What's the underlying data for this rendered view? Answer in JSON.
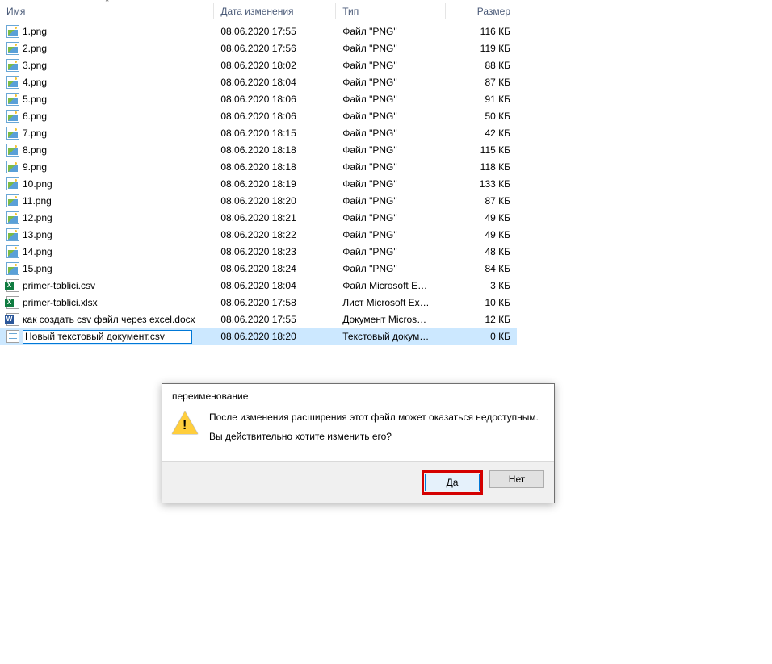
{
  "columns": {
    "name": "Имя",
    "date": "Дата изменения",
    "type": "Тип",
    "size": "Размер"
  },
  "files": [
    {
      "icon": "img",
      "name": "1.png",
      "date": "08.06.2020 17:55",
      "type": "Файл \"PNG\"",
      "size": "116 КБ"
    },
    {
      "icon": "img",
      "name": "2.png",
      "date": "08.06.2020 17:56",
      "type": "Файл \"PNG\"",
      "size": "119 КБ"
    },
    {
      "icon": "img",
      "name": "3.png",
      "date": "08.06.2020 18:02",
      "type": "Файл \"PNG\"",
      "size": "88 КБ"
    },
    {
      "icon": "img",
      "name": "4.png",
      "date": "08.06.2020 18:04",
      "type": "Файл \"PNG\"",
      "size": "87 КБ"
    },
    {
      "icon": "img",
      "name": "5.png",
      "date": "08.06.2020 18:06",
      "type": "Файл \"PNG\"",
      "size": "91 КБ"
    },
    {
      "icon": "img",
      "name": "6.png",
      "date": "08.06.2020 18:06",
      "type": "Файл \"PNG\"",
      "size": "50 КБ"
    },
    {
      "icon": "img",
      "name": "7.png",
      "date": "08.06.2020 18:15",
      "type": "Файл \"PNG\"",
      "size": "42 КБ"
    },
    {
      "icon": "img",
      "name": "8.png",
      "date": "08.06.2020 18:18",
      "type": "Файл \"PNG\"",
      "size": "115 КБ"
    },
    {
      "icon": "img",
      "name": "9.png",
      "date": "08.06.2020 18:18",
      "type": "Файл \"PNG\"",
      "size": "118 КБ"
    },
    {
      "icon": "img",
      "name": "10.png",
      "date": "08.06.2020 18:19",
      "type": "Файл \"PNG\"",
      "size": "133 КБ"
    },
    {
      "icon": "img",
      "name": "11.png",
      "date": "08.06.2020 18:20",
      "type": "Файл \"PNG\"",
      "size": "87 КБ"
    },
    {
      "icon": "img",
      "name": "12.png",
      "date": "08.06.2020 18:21",
      "type": "Файл \"PNG\"",
      "size": "49 КБ"
    },
    {
      "icon": "img",
      "name": "13.png",
      "date": "08.06.2020 18:22",
      "type": "Файл \"PNG\"",
      "size": "49 КБ"
    },
    {
      "icon": "img",
      "name": "14.png",
      "date": "08.06.2020 18:23",
      "type": "Файл \"PNG\"",
      "size": "48 КБ"
    },
    {
      "icon": "img",
      "name": "15.png",
      "date": "08.06.2020 18:24",
      "type": "Файл \"PNG\"",
      "size": "84 КБ"
    },
    {
      "icon": "xls",
      "name": "primer-tablici.csv",
      "date": "08.06.2020 18:04",
      "type": "Файл Microsoft E…",
      "size": "3 КБ"
    },
    {
      "icon": "xls",
      "name": "primer-tablici.xlsx",
      "date": "08.06.2020 17:58",
      "type": "Лист Microsoft Ex…",
      "size": "10 КБ"
    },
    {
      "icon": "doc",
      "name": "как создать csv файл через excel.docx",
      "date": "08.06.2020 17:55",
      "type": "Документ Micros…",
      "size": "12 КБ"
    },
    {
      "icon": "txt",
      "name": "Новый текстовый документ.csv",
      "date": "08.06.2020 18:20",
      "type": "Текстовый докум…",
      "size": "0 КБ",
      "selected": true,
      "renaming": true
    }
  ],
  "dialog": {
    "title": "переименование",
    "line1": "После изменения расширения этот файл может оказаться недоступным.",
    "line2": "Вы действительно хотите изменить его?",
    "yes": "Да",
    "no": "Нет"
  }
}
